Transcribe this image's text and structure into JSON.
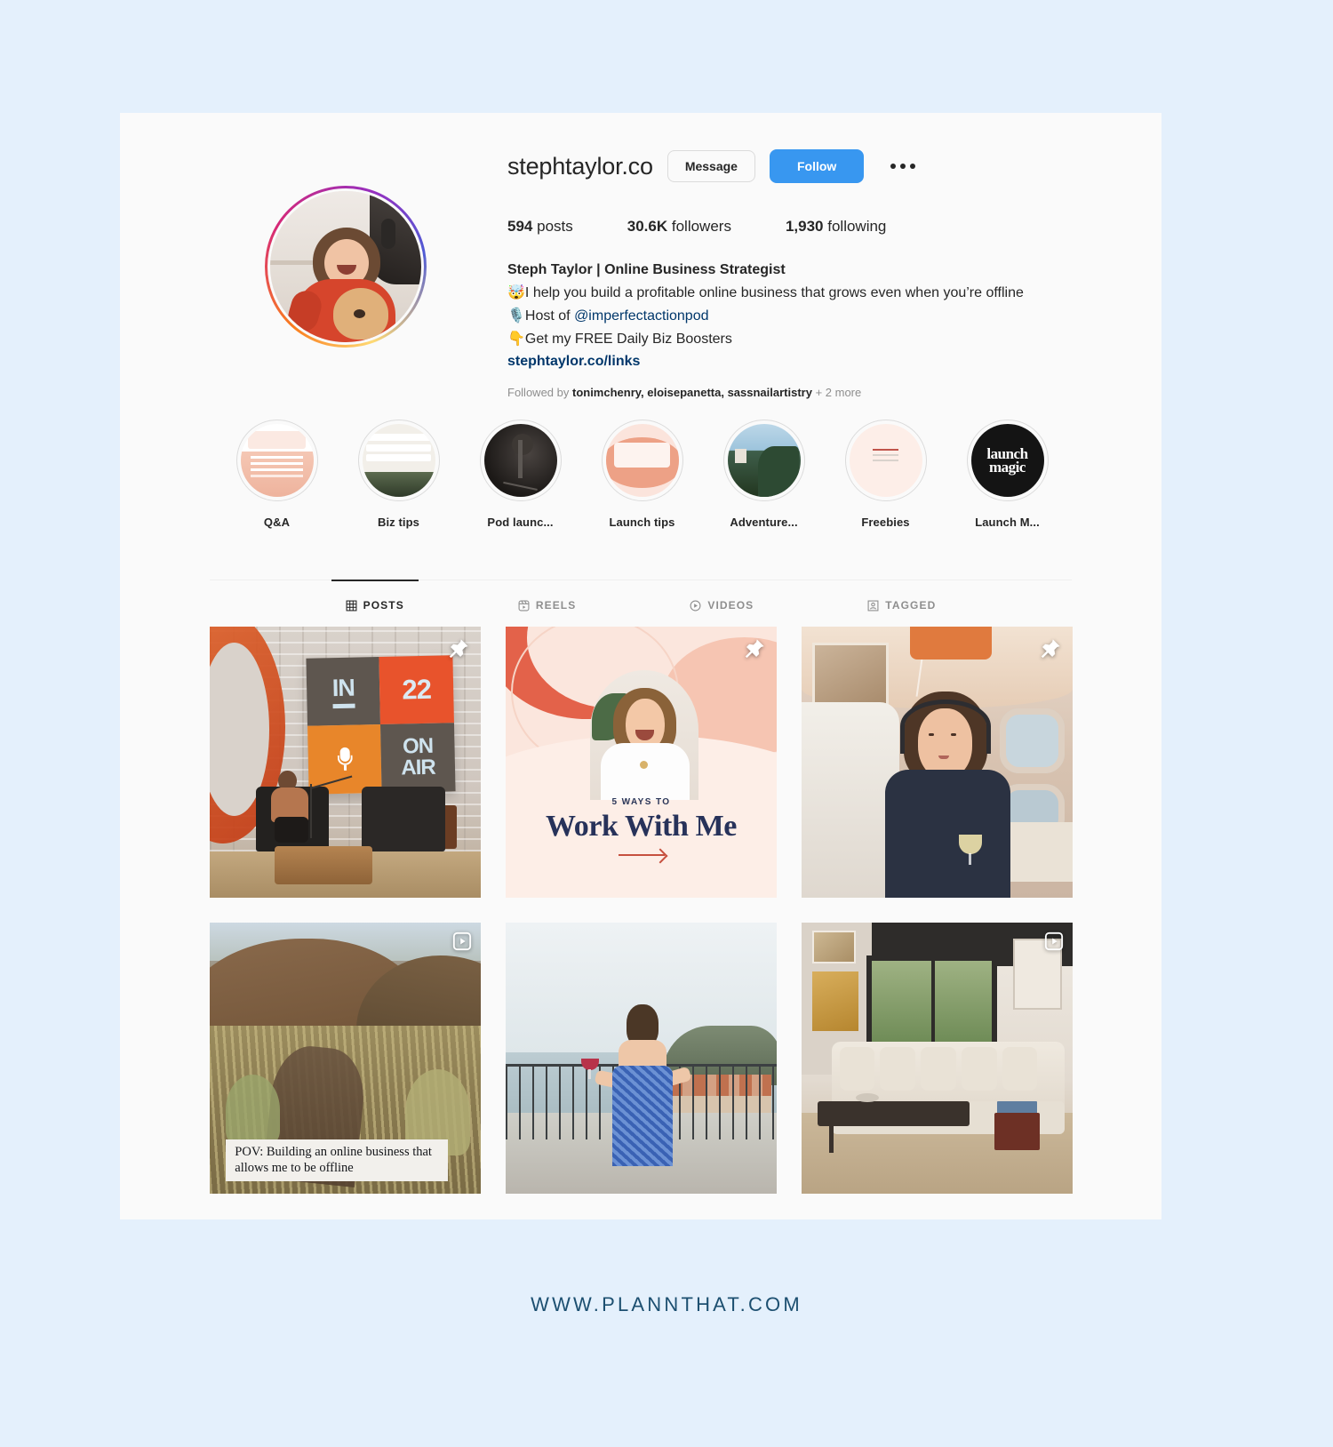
{
  "profile": {
    "username": "stephtaylor.co",
    "message_label": "Message",
    "follow_label": "Follow",
    "more_options": "more-options",
    "stats": [
      {
        "value": "594",
        "label": "posts"
      },
      {
        "value": "30.6K",
        "label": "followers"
      },
      {
        "value": "1,930",
        "label": "following"
      }
    ],
    "display_name": "Steph Taylor | Online Business Strategist",
    "bio_lines": [
      {
        "emoji": "🤯",
        "text": "I help you build a profitable online business that grows even when you’re offline"
      },
      {
        "emoji": "🎙️",
        "text": "Host of ",
        "mention": "@imperfectactionpod"
      },
      {
        "emoji": "👇",
        "text": "Get my FREE Daily Biz Boosters"
      }
    ],
    "website": "stephtaylor.co/links",
    "followed_by": {
      "prefix": "Followed by ",
      "names": "tonimchenry, eloisepanetta, sassnailartistry",
      "suffix": " + 2 more"
    }
  },
  "highlights": [
    {
      "label": "Q&A"
    },
    {
      "label": "Biz tips"
    },
    {
      "label": "Pod launc..."
    },
    {
      "label": "Launch tips"
    },
    {
      "label": "Adventure..."
    },
    {
      "label": "Freebies"
    },
    {
      "label": "Launch M..."
    }
  ],
  "tabs": [
    {
      "label": "POSTS",
      "icon": "grid-icon",
      "active": true
    },
    {
      "label": "REELS",
      "icon": "reels-icon",
      "active": false
    },
    {
      "label": "VIDEOS",
      "icon": "video-icon",
      "active": false
    },
    {
      "label": "TAGGED",
      "icon": "tagged-icon",
      "active": false
    }
  ],
  "posts": [
    {
      "name": "post-on-air-stage",
      "pinned": true,
      "type": "image",
      "overlay_text": {
        "q1": "IN",
        "q2": "22",
        "q3": "mic-icon",
        "q4a": "ON",
        "q4b": "AIR"
      }
    },
    {
      "name": "post-work-with-me",
      "pinned": true,
      "type": "image",
      "kicker": "5 WAYS TO",
      "headline": "Work With Me"
    },
    {
      "name": "post-airplane",
      "pinned": true,
      "type": "image"
    },
    {
      "name": "post-hills-reel",
      "pinned": false,
      "type": "reel",
      "caption": "POV: Building an online business that allows me to be offline"
    },
    {
      "name": "post-seaside",
      "pinned": false,
      "type": "image"
    },
    {
      "name": "post-living-room",
      "pinned": false,
      "type": "reel"
    }
  ],
  "footer": {
    "text": "WWW.PLANNTHAT.COM"
  },
  "colors": {
    "page_background": "#e4f0fc",
    "card_background": "#fafafa",
    "follow_blue": "#3897f0",
    "link_blue": "#00376b",
    "text_primary": "#262626",
    "text_secondary": "#8e8e8e",
    "footer_text": "#1c4f70"
  }
}
